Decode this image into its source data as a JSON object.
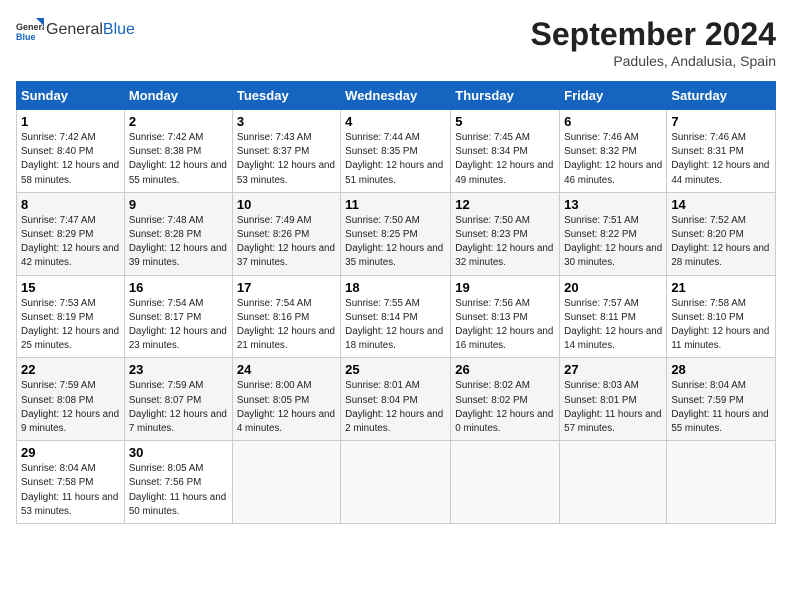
{
  "logo": {
    "general": "General",
    "blue": "Blue"
  },
  "title": "September 2024",
  "subtitle": "Padules, Andalusia, Spain",
  "days_of_week": [
    "Sunday",
    "Monday",
    "Tuesday",
    "Wednesday",
    "Thursday",
    "Friday",
    "Saturday"
  ],
  "weeks": [
    [
      {
        "day": "1",
        "sunrise": "7:42 AM",
        "sunset": "8:40 PM",
        "daylight": "12 hours and 58 minutes."
      },
      {
        "day": "2",
        "sunrise": "7:42 AM",
        "sunset": "8:38 PM",
        "daylight": "12 hours and 55 minutes."
      },
      {
        "day": "3",
        "sunrise": "7:43 AM",
        "sunset": "8:37 PM",
        "daylight": "12 hours and 53 minutes."
      },
      {
        "day": "4",
        "sunrise": "7:44 AM",
        "sunset": "8:35 PM",
        "daylight": "12 hours and 51 minutes."
      },
      {
        "day": "5",
        "sunrise": "7:45 AM",
        "sunset": "8:34 PM",
        "daylight": "12 hours and 49 minutes."
      },
      {
        "day": "6",
        "sunrise": "7:46 AM",
        "sunset": "8:32 PM",
        "daylight": "12 hours and 46 minutes."
      },
      {
        "day": "7",
        "sunrise": "7:46 AM",
        "sunset": "8:31 PM",
        "daylight": "12 hours and 44 minutes."
      }
    ],
    [
      {
        "day": "8",
        "sunrise": "7:47 AM",
        "sunset": "8:29 PM",
        "daylight": "12 hours and 42 minutes."
      },
      {
        "day": "9",
        "sunrise": "7:48 AM",
        "sunset": "8:28 PM",
        "daylight": "12 hours and 39 minutes."
      },
      {
        "day": "10",
        "sunrise": "7:49 AM",
        "sunset": "8:26 PM",
        "daylight": "12 hours and 37 minutes."
      },
      {
        "day": "11",
        "sunrise": "7:50 AM",
        "sunset": "8:25 PM",
        "daylight": "12 hours and 35 minutes."
      },
      {
        "day": "12",
        "sunrise": "7:50 AM",
        "sunset": "8:23 PM",
        "daylight": "12 hours and 32 minutes."
      },
      {
        "day": "13",
        "sunrise": "7:51 AM",
        "sunset": "8:22 PM",
        "daylight": "12 hours and 30 minutes."
      },
      {
        "day": "14",
        "sunrise": "7:52 AM",
        "sunset": "8:20 PM",
        "daylight": "12 hours and 28 minutes."
      }
    ],
    [
      {
        "day": "15",
        "sunrise": "7:53 AM",
        "sunset": "8:19 PM",
        "daylight": "12 hours and 25 minutes."
      },
      {
        "day": "16",
        "sunrise": "7:54 AM",
        "sunset": "8:17 PM",
        "daylight": "12 hours and 23 minutes."
      },
      {
        "day": "17",
        "sunrise": "7:54 AM",
        "sunset": "8:16 PM",
        "daylight": "12 hours and 21 minutes."
      },
      {
        "day": "18",
        "sunrise": "7:55 AM",
        "sunset": "8:14 PM",
        "daylight": "12 hours and 18 minutes."
      },
      {
        "day": "19",
        "sunrise": "7:56 AM",
        "sunset": "8:13 PM",
        "daylight": "12 hours and 16 minutes."
      },
      {
        "day": "20",
        "sunrise": "7:57 AM",
        "sunset": "8:11 PM",
        "daylight": "12 hours and 14 minutes."
      },
      {
        "day": "21",
        "sunrise": "7:58 AM",
        "sunset": "8:10 PM",
        "daylight": "12 hours and 11 minutes."
      }
    ],
    [
      {
        "day": "22",
        "sunrise": "7:59 AM",
        "sunset": "8:08 PM",
        "daylight": "12 hours and 9 minutes."
      },
      {
        "day": "23",
        "sunrise": "7:59 AM",
        "sunset": "8:07 PM",
        "daylight": "12 hours and 7 minutes."
      },
      {
        "day": "24",
        "sunrise": "8:00 AM",
        "sunset": "8:05 PM",
        "daylight": "12 hours and 4 minutes."
      },
      {
        "day": "25",
        "sunrise": "8:01 AM",
        "sunset": "8:04 PM",
        "daylight": "12 hours and 2 minutes."
      },
      {
        "day": "26",
        "sunrise": "8:02 AM",
        "sunset": "8:02 PM",
        "daylight": "12 hours and 0 minutes."
      },
      {
        "day": "27",
        "sunrise": "8:03 AM",
        "sunset": "8:01 PM",
        "daylight": "11 hours and 57 minutes."
      },
      {
        "day": "28",
        "sunrise": "8:04 AM",
        "sunset": "7:59 PM",
        "daylight": "11 hours and 55 minutes."
      }
    ],
    [
      {
        "day": "29",
        "sunrise": "8:04 AM",
        "sunset": "7:58 PM",
        "daylight": "11 hours and 53 minutes."
      },
      {
        "day": "30",
        "sunrise": "8:05 AM",
        "sunset": "7:56 PM",
        "daylight": "11 hours and 50 minutes."
      },
      null,
      null,
      null,
      null,
      null
    ]
  ],
  "labels": {
    "sunrise": "Sunrise:",
    "sunset": "Sunset:",
    "daylight": "Daylight:"
  }
}
